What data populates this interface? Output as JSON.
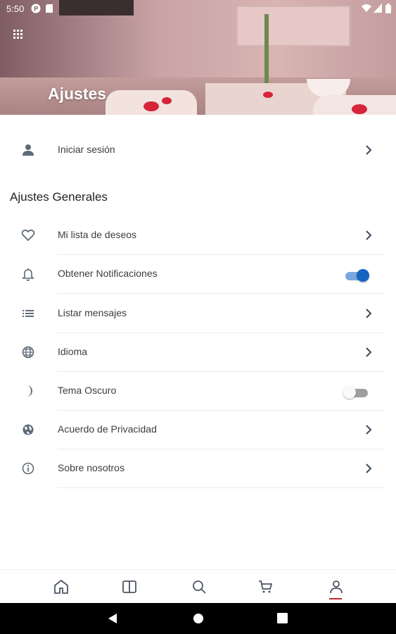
{
  "status_bar": {
    "time": "5:50",
    "icons": [
      "notification-p-icon",
      "sd-card-icon",
      "wifi-icon",
      "signal-icon",
      "battery-icon"
    ]
  },
  "header": {
    "title": "Ajustes",
    "menu_icon": "grid-icon"
  },
  "login": {
    "label": "Iniciar sesión",
    "icon": "person-icon"
  },
  "general_settings": {
    "title": "Ajustes Generales",
    "items": [
      {
        "label": "Mi lista de deseos",
        "icon": "heart-icon",
        "control": "chevron"
      },
      {
        "label": "Obtener Notificaciones",
        "icon": "bell-icon",
        "control": "toggle",
        "enabled": true
      },
      {
        "label": "Listar mensajes",
        "icon": "list-icon",
        "control": "chevron"
      },
      {
        "label": "Idioma",
        "icon": "globe-icon",
        "control": "chevron"
      },
      {
        "label": "Tema Oscuro",
        "icon": "moon-icon",
        "control": "toggle",
        "enabled": false
      },
      {
        "label": "Acuerdo de Privacidad",
        "icon": "privacy-globe-icon",
        "control": "chevron"
      },
      {
        "label": "Sobre nosotros",
        "icon": "info-icon",
        "control": "chevron"
      }
    ]
  },
  "bottom_nav": {
    "items": [
      "home-icon",
      "catalog-icon",
      "search-icon",
      "cart-icon",
      "profile-icon"
    ],
    "active": "profile-icon"
  },
  "colors": {
    "toggle_on": "#1565c0",
    "toggle_on_track": "#7aa7e0",
    "toggle_off_knob": "#fafafa",
    "toggle_off_track": "#9e9e9e",
    "active_underline": "#c0262e",
    "icon": "#5f6b7a"
  }
}
